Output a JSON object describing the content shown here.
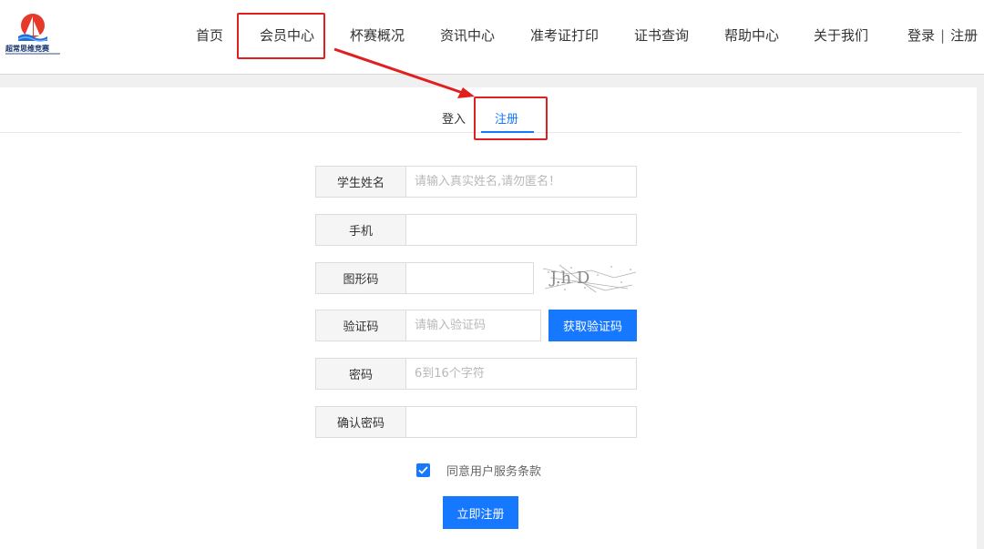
{
  "header": {
    "logo_text": "超常思维竞赛",
    "nav": [
      "首页",
      "会员中心",
      "杯赛概况",
      "资讯中心",
      "准考证打印",
      "证书查询",
      "帮助中心",
      "关于我们"
    ],
    "login": "登录",
    "separator": "|",
    "register": "注册"
  },
  "tabs": {
    "login": "登入",
    "register": "注册",
    "active": "register"
  },
  "form": {
    "name": {
      "label": "学生姓名",
      "placeholder": "请输入真实姓名,请勿匿名！"
    },
    "phone": {
      "label": "手机",
      "placeholder": ""
    },
    "captcha": {
      "label": "图形码",
      "placeholder": "",
      "image_text": "J.h D"
    },
    "sms": {
      "label": "验证码",
      "placeholder": "请输入验证码",
      "button": "获取验证码"
    },
    "password": {
      "label": "密码",
      "placeholder": "6到16个字符"
    },
    "confirm": {
      "label": "确认密码",
      "placeholder": ""
    },
    "agree": {
      "text": "同意用户服务条款",
      "checked": true
    },
    "submit": "立即注册"
  },
  "colors": {
    "accent": "#1677ff",
    "highlight": "#e02020"
  }
}
